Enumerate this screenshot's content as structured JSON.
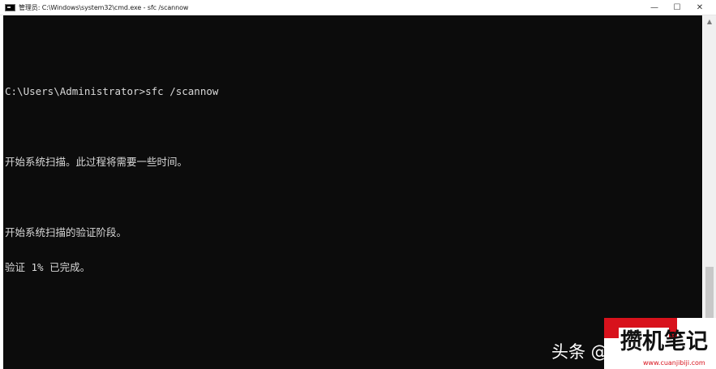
{
  "window": {
    "title": "管理员: C:\\Windows\\system32\\cmd.exe - sfc  /scannow",
    "controls": {
      "minimize": "—",
      "maximize": "☐",
      "close": "✕"
    }
  },
  "console": {
    "lines": [
      "",
      "C:\\Users\\Administrator>sfc /scannow",
      "",
      "开始系统扫描。此过程将需要一些时间。",
      "",
      "开始系统扫描的验证阶段。",
      "验证 1% 已完成。"
    ],
    "colors": {
      "background": "#0c0c0c",
      "text": "#d9d9d9"
    }
  },
  "watermark": {
    "text": "头条 @",
    "logo_text": "攒机笔记",
    "logo_url": "www.cuanjibiji.com"
  }
}
